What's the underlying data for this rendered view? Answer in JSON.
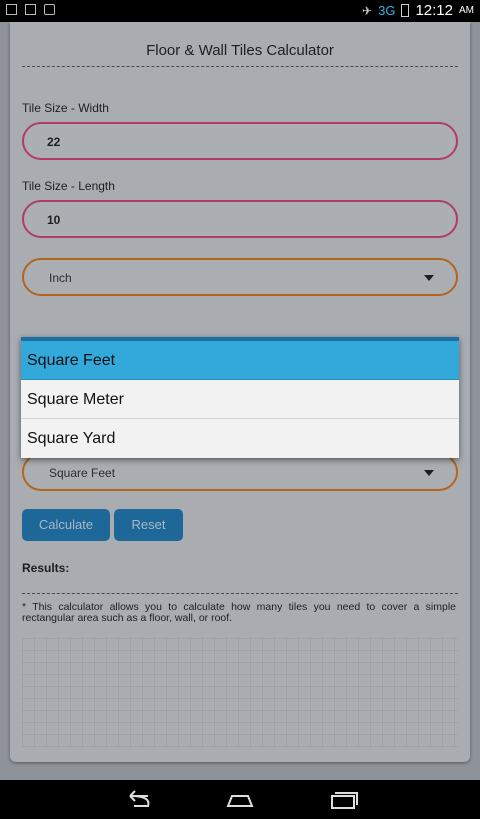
{
  "status_bar": {
    "network": "3G",
    "time": "12:12",
    "ampm": "AM"
  },
  "app": {
    "title": "Floor & Wall Tiles Calculator",
    "width_label": "Tile Size - Width",
    "width_value": "22",
    "length_label": "Tile Size - Length",
    "length_value": "10",
    "unit_select": "Inch",
    "area_select": "Square Feet",
    "calculate_label": "Calculate",
    "reset_label": "Reset",
    "results_label": "Results:",
    "note": "* This calculator allows you to calculate how many tiles you need to cover a simple rectangular area such as a floor, wall, or roof."
  },
  "dropdown": {
    "options": [
      "Square Feet",
      "Square Meter",
      "Square Yard"
    ],
    "selected": "Square Feet"
  },
  "colors": {
    "field_border": "#b23c69",
    "select_border": "#b3651e",
    "button": "#1d6898",
    "dropdown_selected": "#33a8da"
  },
  "icons": [
    "back-icon",
    "home-icon",
    "recent-apps-icon",
    "signal-icon",
    "battery-icon",
    "lock-icon"
  ]
}
